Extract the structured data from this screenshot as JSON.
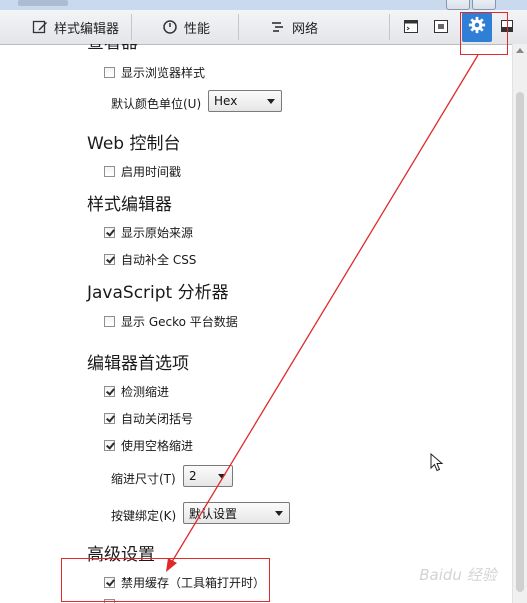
{
  "toolbar": {
    "tabs": [
      {
        "label": "样式编辑器",
        "icon": "pencil-icon"
      },
      {
        "label": "性能",
        "icon": "gauge-icon"
      },
      {
        "label": "网络",
        "icon": "network-icon"
      }
    ],
    "right_icons": [
      "console-split-icon",
      "responsive-icon",
      "settings-gear-icon",
      "dock-icon"
    ],
    "accent": "#2f7fd6"
  },
  "settings": {
    "inspector": {
      "heading": "查看器",
      "show_browser_styles": {
        "label": "显示浏览器样式",
        "checked": false
      },
      "color_unit": {
        "label": "默认颜色单位(U)",
        "value": "Hex"
      }
    },
    "webconsole": {
      "heading": "Web 控制台",
      "timestamps": {
        "label": "启用时间戳",
        "checked": false
      }
    },
    "style_editor": {
      "heading": "样式编辑器",
      "original_sources": {
        "label": "显示原始来源",
        "checked": true
      },
      "autocomplete_css": {
        "label": "自动补全 CSS",
        "checked": true
      }
    },
    "profiler": {
      "heading": "JavaScript 分析器",
      "gecko_platform": {
        "label": "显示 Gecko 平台数据",
        "checked": false
      }
    },
    "editor": {
      "heading": "编辑器首选项",
      "detect_indent": {
        "label": "检测缩进",
        "checked": true
      },
      "auto_close_brackets": {
        "label": "自动关闭括号",
        "checked": true
      },
      "indent_with_spaces": {
        "label": "使用空格缩进",
        "checked": true
      },
      "tab_size": {
        "label": "缩进尺寸(T)",
        "value": "2"
      },
      "keybindings": {
        "label": "按键绑定(K)",
        "value": "默认设置"
      }
    },
    "advanced": {
      "heading": "高级设置",
      "disable_cache": {
        "label": "禁用缓存（工具箱打开时）",
        "checked": true
      }
    }
  },
  "annotation": {
    "color": "#e02a2a"
  },
  "watermark": {
    "text": "Baidu 经验"
  }
}
